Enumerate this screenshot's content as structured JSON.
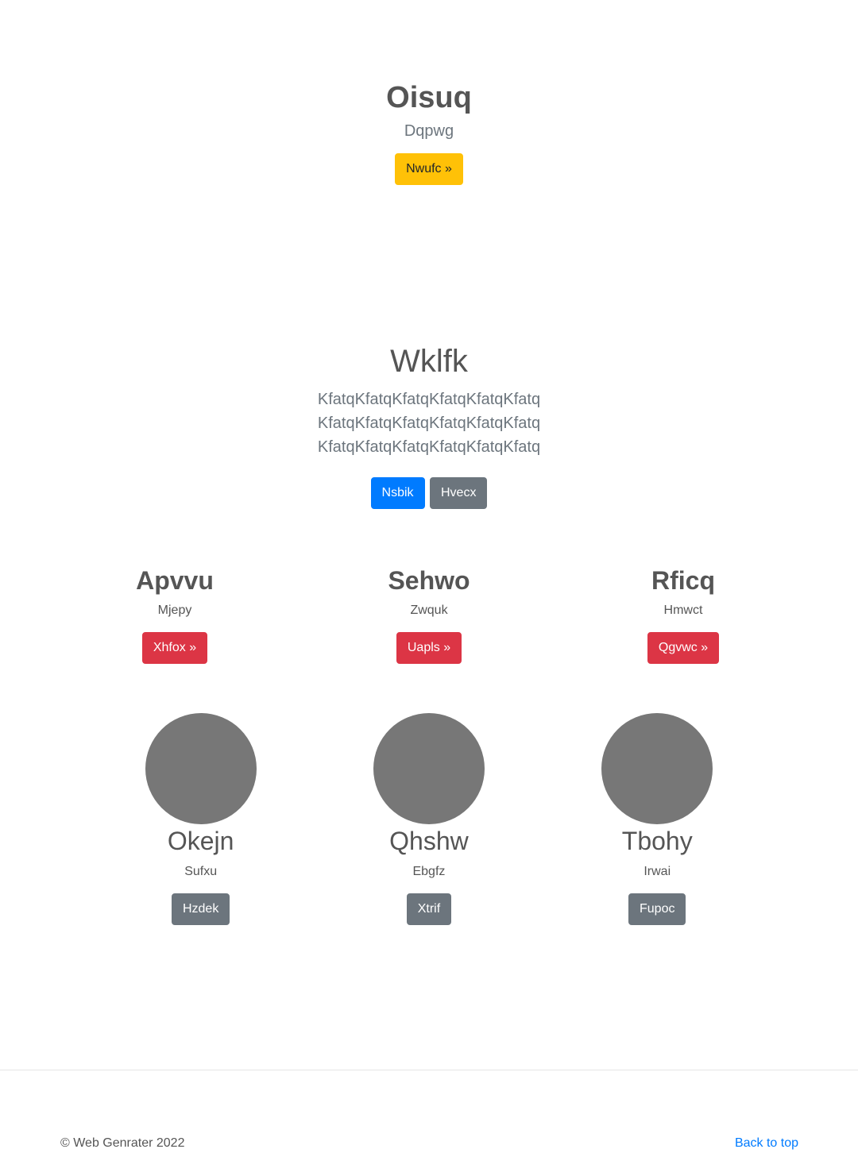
{
  "hero": {
    "title": "Oisuq",
    "lead": "Dqpwg",
    "button_label": "Nwufc »"
  },
  "jumbotron": {
    "title": "Wklfk",
    "text": "KfatqKfatqKfatqKfatqKfatqKfatq KfatqKfatqKfatqKfatqKfatqKfatq KfatqKfatqKfatqKfatqKfatqKfatq",
    "primary_button": "Nsbik",
    "secondary_button": "Hvecx"
  },
  "features": [
    {
      "title": "Apvvu",
      "subtitle": "Mjepy",
      "button": "Xhfox »"
    },
    {
      "title": "Sehwo",
      "subtitle": "Zwquk",
      "button": "Uapls »"
    },
    {
      "title": "Rficq",
      "subtitle": "Hmwct",
      "button": "Qgvwc »"
    }
  ],
  "people": [
    {
      "name": "Okejn",
      "subtitle": "Sufxu",
      "button": "Hzdek"
    },
    {
      "name": "Qhshw",
      "subtitle": "Ebgfz",
      "button": "Xtrif"
    },
    {
      "name": "Tbohy",
      "subtitle": "Irwai",
      "button": "Fupoc"
    }
  ],
  "footer": {
    "copyright": "© Web Genrater 2022",
    "back_to_top": "Back to top"
  },
  "colors": {
    "warning": "#ffc107",
    "primary": "#007bff",
    "secondary": "#6c757d",
    "danger": "#dc3545",
    "avatar": "#777777"
  }
}
